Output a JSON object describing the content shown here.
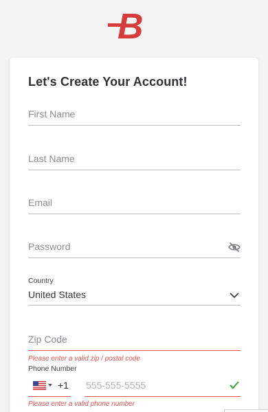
{
  "brand": {
    "color": "#d63c3c",
    "logo_letter": "B"
  },
  "form": {
    "title": "Let's Create Your Account!",
    "first_name": {
      "placeholder": "First Name"
    },
    "last_name": {
      "placeholder": "Last Name"
    },
    "email": {
      "placeholder": "Email"
    },
    "password": {
      "placeholder": "Password",
      "icon": "eye-off-icon"
    },
    "country": {
      "label": "Country",
      "value": "United States",
      "icon": "chevron-down-icon"
    },
    "zip": {
      "placeholder": "Zip Code",
      "error": "Please enter a valid zip / postal code"
    },
    "phone": {
      "label": "Phone Number",
      "flag": "us-flag-icon",
      "dial_code": "+1",
      "placeholder": "555-555-5555",
      "error": "Please enter a valid phone number",
      "valid_icon": "check-icon"
    }
  },
  "colors": {
    "error": "#e0504e",
    "success": "#3aa33a",
    "line": "#bcbcbc"
  }
}
